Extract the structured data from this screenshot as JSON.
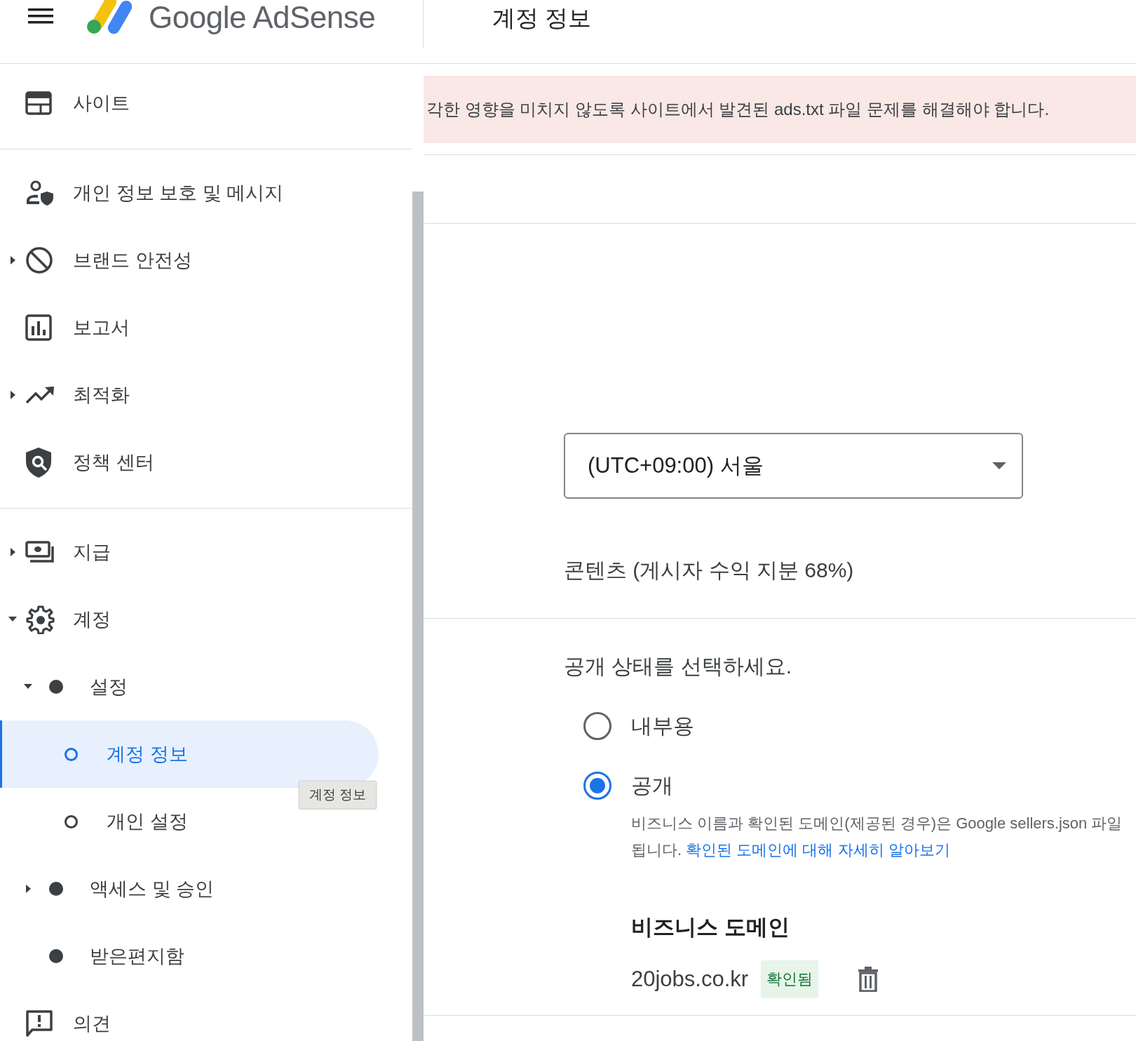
{
  "header": {
    "logo_text": "Google AdSense",
    "page_title": "계정 정보"
  },
  "sidebar": {
    "sections": [
      {
        "items": [
          {
            "label": "사이트",
            "selected": false
          }
        ]
      },
      {
        "items": [
          {
            "label": "개인 정보 보호 및 메시지",
            "selected": false
          },
          {
            "label": "브랜드 안전성",
            "selected": false,
            "expanded": false
          },
          {
            "label": "보고서",
            "selected": false
          },
          {
            "label": "최적화",
            "selected": false,
            "expanded": false
          },
          {
            "label": "정책 센터",
            "selected": false
          }
        ]
      },
      {
        "items": [
          {
            "label": "지급",
            "selected": false,
            "expanded": false
          },
          {
            "label": "계정",
            "selected": false,
            "expanded": true,
            "children": [
              {
                "label": "설정",
                "kind": "dot",
                "selected": false,
                "expanded": true,
                "children": [
                  {
                    "label": "계정 정보",
                    "kind": "ring",
                    "selected": true
                  },
                  {
                    "label": "개인 설정",
                    "kind": "ring",
                    "selected": false
                  }
                ]
              },
              {
                "label": "액세스 및 승인",
                "kind": "dot",
                "selected": false,
                "expanded": false
              },
              {
                "label": "받은편지함",
                "kind": "dot",
                "selected": false
              }
            ]
          },
          {
            "label": "의견",
            "selected": false
          }
        ]
      }
    ]
  },
  "tooltip": {
    "text": "계정 정보"
  },
  "banner": {
    "text": "각한 영향을 미치지 않도록 사이트에서 발견된 ads.txt 파일 문제를 해결해야 합니다."
  },
  "timezone": {
    "value": "(UTC+09:00) 서울"
  },
  "content_type": "콘텐츠 (게시자 수익 지분 68%)",
  "visibility": {
    "prompt": "공개 상태를 선택하세요.",
    "options": [
      {
        "label": "내부용",
        "selected": false
      },
      {
        "label": "공개",
        "selected": true
      }
    ],
    "description_line1": "비즈니스 이름과 확인된 도메인(제공된 경우)은 Google sellers.json 파일",
    "description_line2": "됩니다. ",
    "link": "확인된 도메인에 대해 자세히 알아보기"
  },
  "business_domain": {
    "title": "비즈니스 도메인",
    "domain": "20jobs.co.kr",
    "badge": "확인됨"
  }
}
